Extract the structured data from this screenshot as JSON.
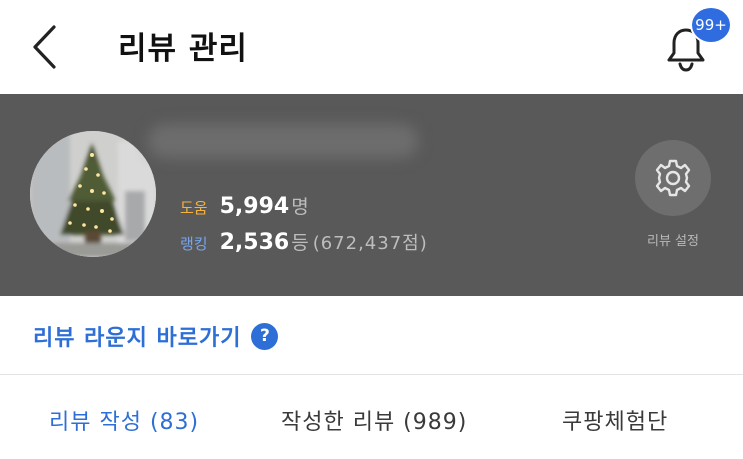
{
  "header": {
    "title": "리뷰 관리",
    "notification_badge": "99+"
  },
  "profile": {
    "help_label": "도움",
    "help_value": "5,994",
    "help_unit": "명",
    "rank_label": "랭킹",
    "rank_value": "2,536",
    "rank_unit": "등",
    "rank_points": "(672,437점)",
    "settings_label": "리뷰 설정"
  },
  "lounge": {
    "link_label": "리뷰 라운지 바로가기",
    "help_icon_glyph": "?"
  },
  "tabs": [
    {
      "label": "리뷰 작성 (83)",
      "active": true
    },
    {
      "label": "작성한 리뷰 (989)",
      "active": false
    },
    {
      "label": "쿠팡체험단",
      "active": false
    }
  ],
  "colors": {
    "accent": "#2d6fd6",
    "badge": "#2f6ce0",
    "help_label": "#f3b33e",
    "rank_label": "#78a4ec",
    "profile_bg": "#595959"
  },
  "icons": [
    "back-chevron-icon",
    "bell-icon",
    "gear-icon",
    "question-icon"
  ]
}
